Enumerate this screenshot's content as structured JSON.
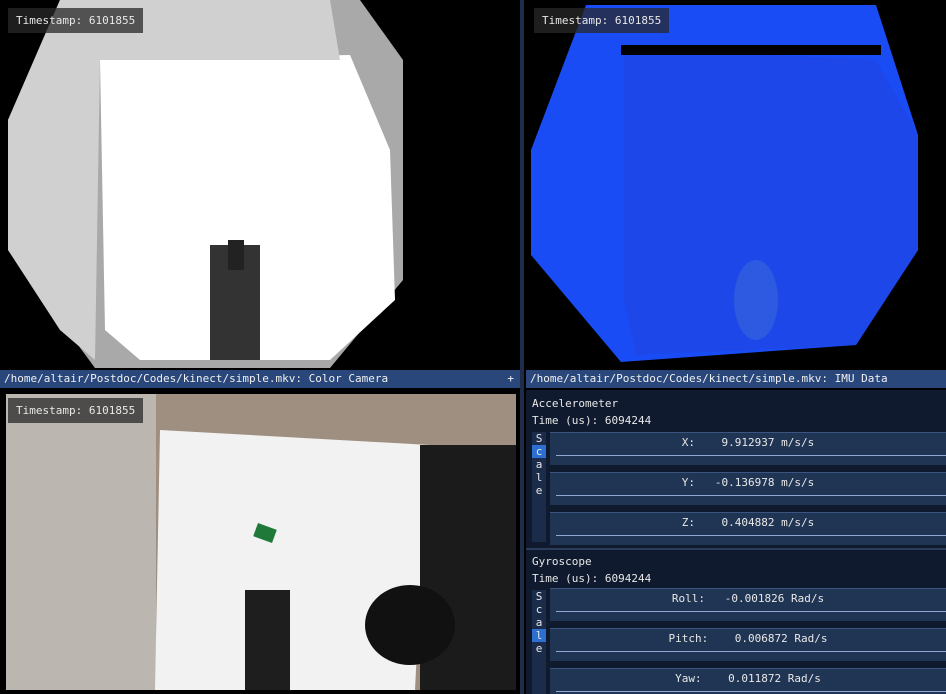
{
  "timestamp_label": "Timestamp: 6101855",
  "color_window": {
    "title": "/home/altair/Postdoc/Codes/kinect/simple.mkv: Color Camera",
    "plus": "+"
  },
  "imu_window": {
    "title": "/home/altair/Postdoc/Codes/kinect/simple.mkv: IMU Data",
    "scale_letters": [
      "S",
      "c",
      "a",
      "l",
      "e"
    ],
    "accelerometer": {
      "title": "Accelerometer",
      "time": "Time (us): 6094244",
      "rows": [
        {
          "label": "X:    9.912937 m/s/s"
        },
        {
          "label": "Y:   -0.136978 m/s/s"
        },
        {
          "label": "Z:    0.404882 m/s/s"
        }
      ]
    },
    "gyroscope": {
      "title": "Gyroscope",
      "time": "Time (us): 6094244",
      "rows": [
        {
          "label": "Roll:   -0.001826 Rad/s"
        },
        {
          "label": "Pitch:    0.006872 Rad/s"
        },
        {
          "label": "Yaw:    0.011872 Rad/s"
        }
      ]
    }
  }
}
